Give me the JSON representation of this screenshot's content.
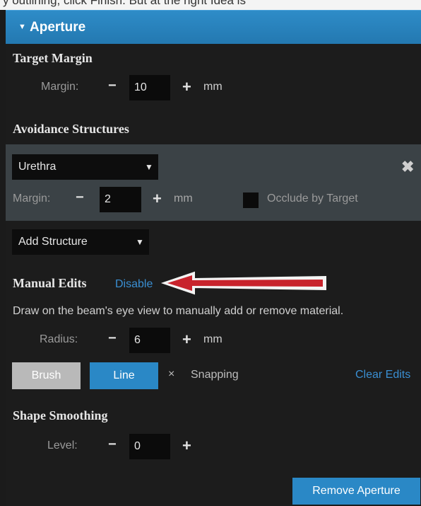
{
  "top_strip_text": "y outlining, click Finish. But at the right Idea is",
  "header": {
    "collapse_icon": "triangle-down-icon",
    "title": "Aperture"
  },
  "target_margin": {
    "title": "Target Margin",
    "label": "Margin:",
    "minus": "−",
    "value": "10",
    "plus": "+",
    "unit": "mm"
  },
  "avoidance": {
    "title": "Avoidance Structures",
    "structure": {
      "selected": "Urethra",
      "remove_icon": "close-icon",
      "margin_label": "Margin:",
      "minus": "−",
      "value": "2",
      "plus": "+",
      "unit": "mm",
      "occlude_label": "Occlude by Target",
      "occlude_checked": false
    },
    "add_structure": "Add Structure"
  },
  "manual_edits": {
    "title": "Manual Edits",
    "toggle_link": "Disable",
    "description": "Draw on the beam's eye view to manually add or remove material.",
    "radius_label": "Radius:",
    "minus": "−",
    "radius_value": "6",
    "plus": "+",
    "unit": "mm",
    "brush_label": "Brush",
    "line_label": "Line",
    "snapping_mark": "×",
    "snapping_label": "Snapping",
    "clear_label": "Clear Edits"
  },
  "shape_smoothing": {
    "title": "Shape Smoothing",
    "level_label": "Level:",
    "minus": "−",
    "level_value": "0",
    "plus": "+"
  },
  "remove_aperture_label": "Remove Aperture",
  "colors": {
    "header_blue": "#2a84c0",
    "active_button_blue": "#2a88c6",
    "inactive_button_gray": "#b9b9b9",
    "link_blue": "#3a8fd3",
    "annotation_arrow_red": "#c8232c"
  }
}
